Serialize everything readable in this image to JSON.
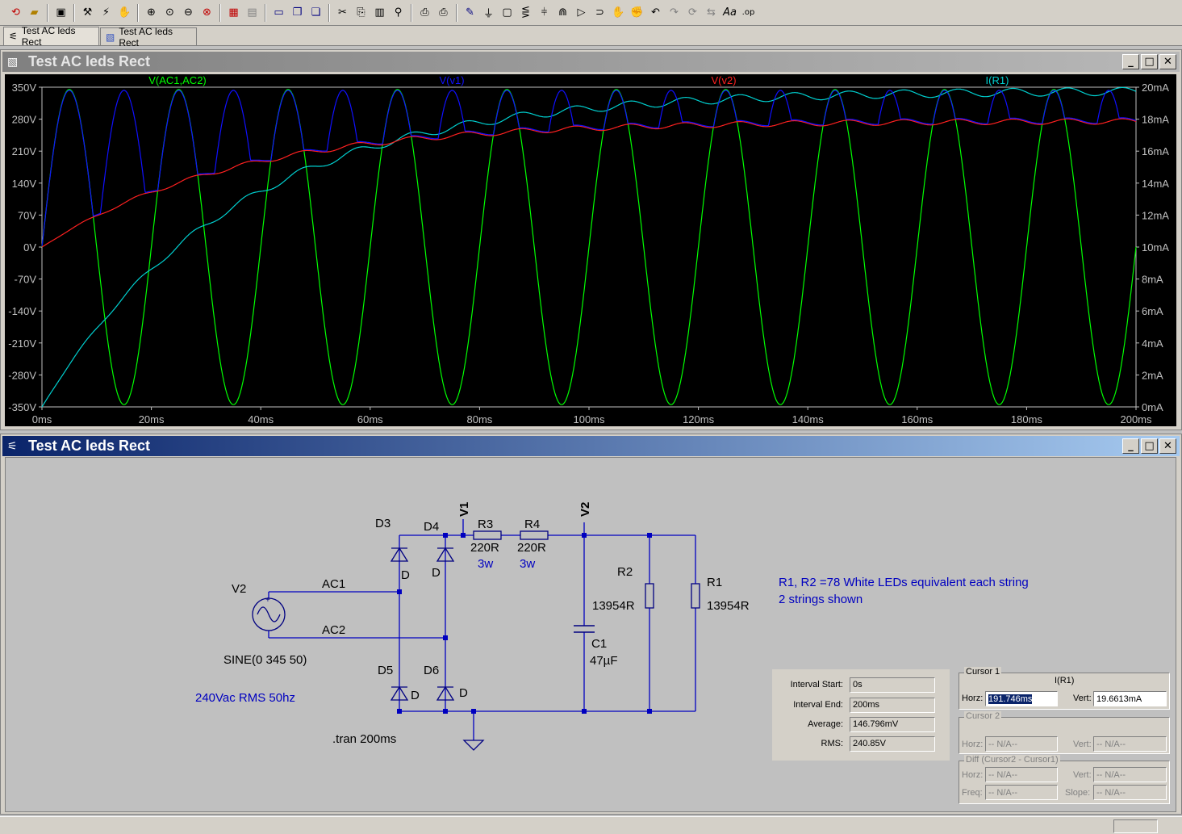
{
  "tabs": [
    {
      "label": "Test AC leds Rect",
      "icon": "schematic-icon"
    },
    {
      "label": "Test AC leds Rect",
      "icon": "waveform-icon"
    }
  ],
  "plot_window": {
    "title": "Test AC leds Rect"
  },
  "schematic_window": {
    "title": "Test AC leds Rect"
  },
  "chart_data": {
    "type": "line",
    "xlabel": "",
    "x_ticks": [
      "0ms",
      "20ms",
      "40ms",
      "60ms",
      "80ms",
      "100ms",
      "120ms",
      "140ms",
      "160ms",
      "180ms",
      "200ms"
    ],
    "xlim": [
      0,
      200
    ],
    "y_ticks_left": [
      "350V",
      "280V",
      "210V",
      "140V",
      "70V",
      "0V",
      "-70V",
      "-140V",
      "-210V",
      "-280V",
      "-350V"
    ],
    "ylim_left": [
      -350,
      350
    ],
    "y_ticks_right": [
      "20mA",
      "18mA",
      "16mA",
      "14mA",
      "12mA",
      "10mA",
      "8mA",
      "6mA",
      "4mA",
      "2mA",
      "0mA"
    ],
    "ylim_right": [
      0,
      20
    ],
    "grid": false,
    "series": [
      {
        "name": "V(AC1,AC2)",
        "color": "#00ff00",
        "axis": "left",
        "kind": "sine",
        "amplitude": 345,
        "frequency_hz": 50
      },
      {
        "name": "V(v1)",
        "color": "#1010ff",
        "axis": "left",
        "kind": "rectified",
        "peak": 343
      },
      {
        "name": "V(v2)",
        "color": "#ff2020",
        "axis": "left",
        "kind": "charging",
        "start": 0,
        "end": 276,
        "tau_ms": 35
      },
      {
        "name": "I(R1)",
        "color": "#00d0d0",
        "axis": "right",
        "kind": "charging",
        "start": 0,
        "end": 19.8,
        "tau_ms": 35
      }
    ]
  },
  "schematic": {
    "labels": {
      "v1": "V1",
      "v2_net": "V2",
      "r3": "R3",
      "r3_val": "220R",
      "r3_w": "3w",
      "r4": "R4",
      "r4_val": "220R",
      "r4_w": "3w",
      "d3": "D3",
      "d4": "D4",
      "d5": "D5",
      "d6": "D6",
      "d": "D",
      "src": "V2",
      "ac1": "AC1",
      "ac2": "AC2",
      "sine": "SINE(0 345 50)",
      "rms": "240Vac RMS 50hz",
      "tran": ".tran 200ms",
      "c1": "C1",
      "c1_val": "47µF",
      "r2": "R2",
      "r2_val": "13954R",
      "r1": "R1",
      "r1_val": "13954R",
      "note1": "R1, R2 =78 White LEDs equivalent each string",
      "note2": "2 strings shown"
    }
  },
  "measure": {
    "interval_start_label": "Interval Start:",
    "interval_start": "0s",
    "interval_end_label": "Interval End:",
    "interval_end": "200ms",
    "average_label": "Average:",
    "average": "146.796mV",
    "rms_label": "RMS:",
    "rms": "240.85V"
  },
  "cursor1": {
    "legend": "Cursor 1",
    "trace": "I(R1)",
    "horz_label": "Horz:",
    "horz": "191.746ms",
    "vert_label": "Vert:",
    "vert": "19.6613mA"
  },
  "cursor2": {
    "legend": "Cursor 2",
    "horz_label": "Horz:",
    "horz": "-- N/A--",
    "vert_label": "Vert:",
    "vert": "-- N/A--"
  },
  "diff": {
    "legend": "Diff (Cursor2 - Cursor1)",
    "horz_label": "Horz:",
    "horz": "-- N/A--",
    "vert_label": "Vert:",
    "vert": "-- N/A--",
    "freq_label": "Freq:",
    "freq": "-- N/A--",
    "slope_label": "Slope:",
    "slope": "-- N/A--"
  }
}
